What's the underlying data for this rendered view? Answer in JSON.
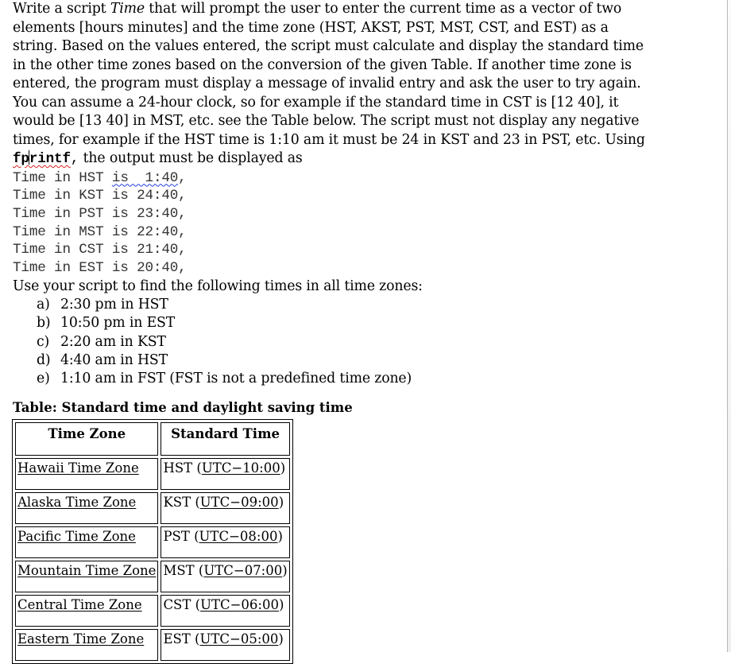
{
  "document": {
    "intro_lines": [
      [
        "Write a script ",
        {
          "italic": "Time"
        },
        " that will prompt the user to enter the current time as a vector of two"
      ],
      "elements [hours minutes] and the time zone (HST, AKST, PST, MST, CST, and EST) as a",
      "string.  Based on the values entered, the script must calculate and display the standard time",
      "in the other time zones based on the conversion of the given Table.  If another time zone is",
      "entered, the program must display a message of invalid entry and ask the user to try again.",
      "You can assume a 24-hour clock, so for example if the standard time in CST is [12 40], it",
      "would be [13 40] in MST, etc. see the Table below. The script must not display any negative",
      "times, for example if the HST time is 1:10 am it must be 24 in KST and 23 in PST, etc. Using"
    ],
    "line1_pre": "Write a script ",
    "line1_italic": "Time",
    "line1_post": " that will prompt the user to enter the current time as a vector of two",
    "lines": [
      "elements [hours minutes] and the time zone (HST, AKST, PST, MST, CST, and EST) as a",
      "string.  Based on the values entered, the script must calculate and display the standard time",
      "in the other time zones based on the conversion of the given Table.  If another time zone is",
      "entered, the program must display a message of invalid entry and ask the user to try again.",
      "You can assume a 24-hour clock, so for example if the standard time in CST is [12 40], it",
      "would be [13 40] in MST, etc. see the Table below. The script must not display any negative",
      "times, for example if the HST time is 1:10 am it must be 24 in KST and 23 in PST, etc. Using"
    ],
    "fprintf_a": "fp",
    "fprintf_b": "rintf",
    "fprintf_comma": ",",
    "fprintf_post": " the output must be displayed as",
    "code_output": {
      "first_prefix": "Time in HST ",
      "first_underlined": "is  1:40",
      "first_suffix": ",",
      "lines": [
        "Time in KST is 24:40,",
        "Time in PST is 23:40,",
        "Time in MST is 22:40,",
        "Time in CST is 21:40,",
        "Time in EST is 20:40,"
      ]
    },
    "tasks_intro": "Use your script to find the following times in all time zones:",
    "tasks": [
      {
        "marker": "a)",
        "text": "2:30 pm in HST"
      },
      {
        "marker": "b)",
        "text": "10:50 pm in EST"
      },
      {
        "marker": "c)",
        "text": "2:20 am in KST"
      },
      {
        "marker": "d)",
        "text": "4:40 am in HST"
      },
      {
        "marker": "e)",
        "text": "1:10 am in FST (FST is not a predefined time zone)"
      }
    ],
    "table": {
      "caption": "Table: Standard time and daylight saving time",
      "headers": [
        "Time Zone",
        "Standard Time"
      ],
      "rows": [
        {
          "zone": "Hawaii Time Zone",
          "abbr": "HST (",
          "utc": "UTC−10:00",
          "close": ")"
        },
        {
          "zone": "Alaska Time Zone",
          "abbr": "KST (",
          "utc": "UTC−09:00",
          "close": ")"
        },
        {
          "zone": "Pacific Time Zone",
          "abbr": "PST (",
          "utc": "UTC−08:00",
          "close": ")"
        },
        {
          "zone": "Mountain Time Zone",
          "abbr": "MST (",
          "utc": "UTC−07:00",
          "close": ")"
        },
        {
          "zone": "Central Time Zone",
          "abbr": "CST (",
          "utc": "UTC−06:00",
          "close": ")"
        },
        {
          "zone": "Eastern Time Zone",
          "abbr": "EST (",
          "utc": "UTC−05:00",
          "close": ")"
        }
      ]
    }
  }
}
